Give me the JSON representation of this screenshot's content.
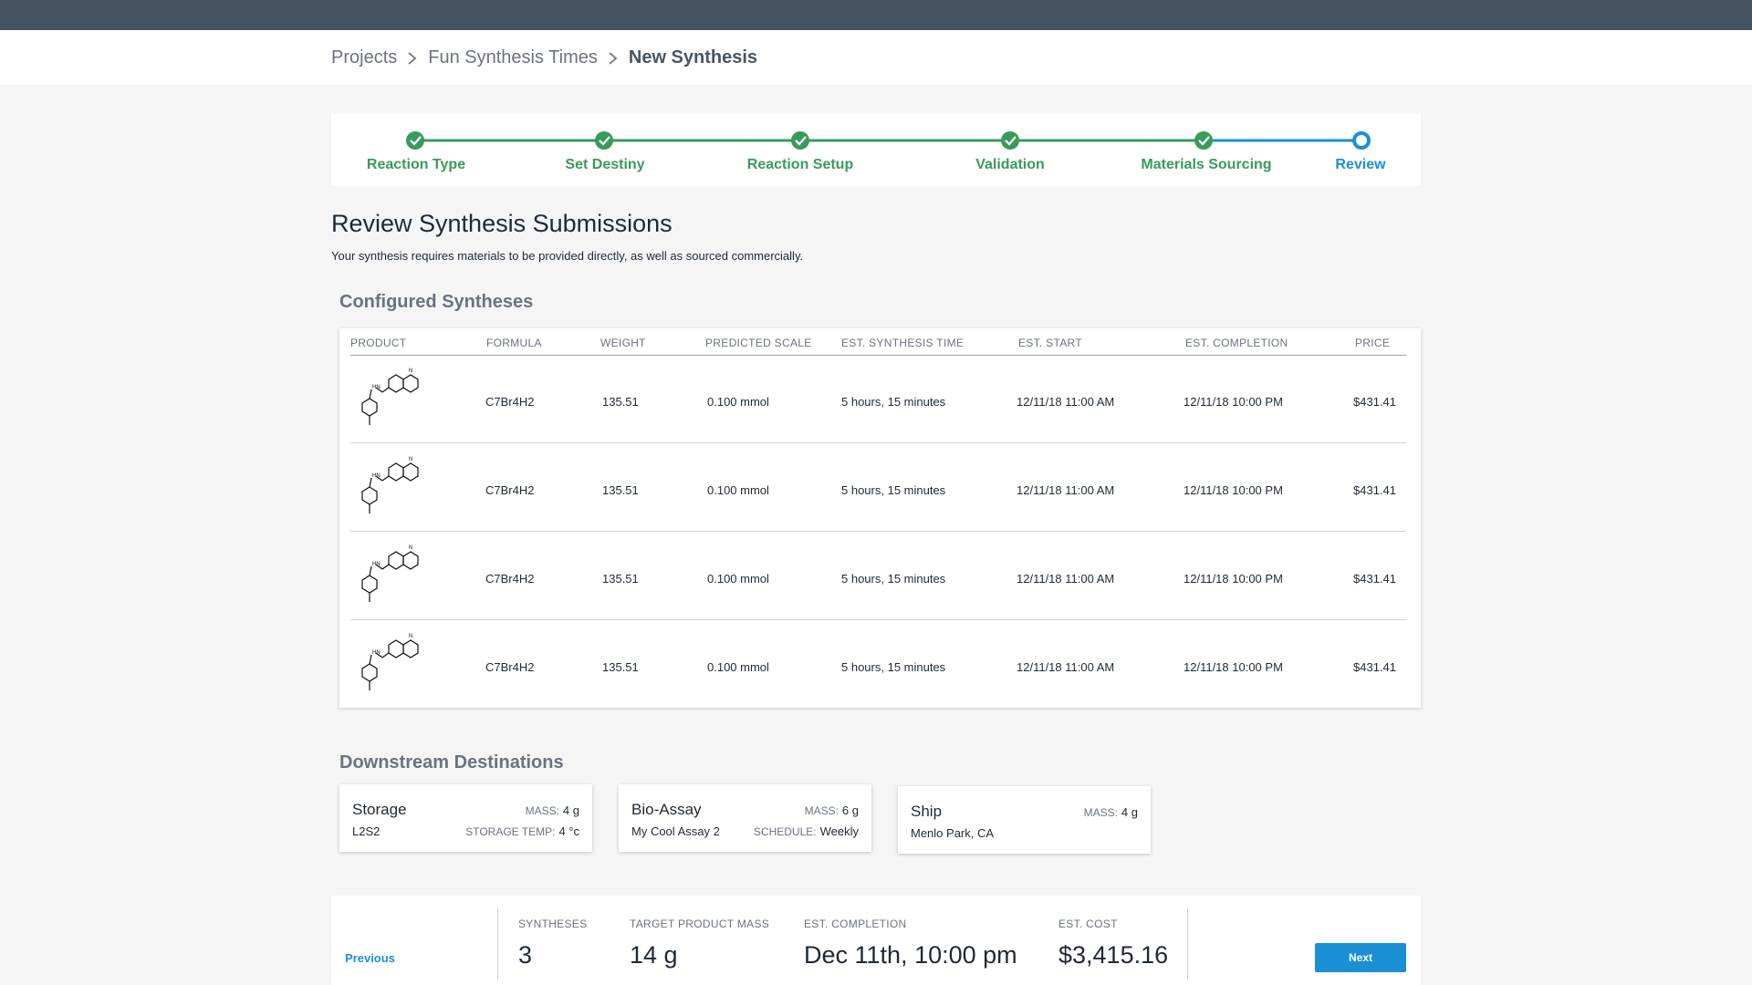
{
  "breadcrumb": {
    "items": [
      "Projects",
      "Fun Synthesis Times"
    ],
    "current": "New Synthesis"
  },
  "stepper": {
    "steps": [
      {
        "label": "Reaction Type",
        "status": "complete"
      },
      {
        "label": "Set Destiny",
        "status": "complete"
      },
      {
        "label": "Reaction Setup",
        "status": "complete"
      },
      {
        "label": "Validation",
        "status": "complete"
      },
      {
        "label": "Materials Sourcing",
        "status": "complete"
      },
      {
        "label": "Review",
        "status": "active"
      }
    ]
  },
  "page": {
    "title": "Review Synthesis Submissions",
    "subtitle": "Your synthesis requires materials to be provided directly, as well as sourced commercially."
  },
  "configured": {
    "title": "Configured Syntheses",
    "columns": [
      "PRODUCT",
      "FORMULA",
      "WEIGHT",
      "PREDICTED SCALE",
      "EST. SYNTHESIS TIME",
      "EST. START",
      "EST. COMPLETION",
      "PRICE"
    ],
    "rows": [
      {
        "formula": "C7Br4H2",
        "weight": "135.51",
        "scale": "0.100 mmol",
        "time": "5 hours, 15 minutes",
        "start": "12/11/18 11:00 AM",
        "completion": "12/11/18 10:00 PM",
        "price": "$431.41"
      },
      {
        "formula": "C7Br4H2",
        "weight": "135.51",
        "scale": "0.100 mmol",
        "time": "5 hours, 15 minutes",
        "start": "12/11/18 11:00 AM",
        "completion": "12/11/18 10:00 PM",
        "price": "$431.41"
      },
      {
        "formula": "C7Br4H2",
        "weight": "135.51",
        "scale": "0.100 mmol",
        "time": "5 hours, 15 minutes",
        "start": "12/11/18 11:00 AM",
        "completion": "12/11/18 10:00 PM",
        "price": "$431.41"
      },
      {
        "formula": "C7Br4H2",
        "weight": "135.51",
        "scale": "0.100 mmol",
        "time": "5 hours, 15 minutes",
        "start": "12/11/18 11:00 AM",
        "completion": "12/11/18 10:00 PM",
        "price": "$431.41"
      }
    ],
    "structure_labels": {
      "amine": "HN",
      "nitrogen": "N"
    }
  },
  "destinations": {
    "title": "Downstream Destinations",
    "cards": [
      {
        "name": "Storage",
        "sub": "L2S2",
        "k1": "MASS:",
        "v1": "4 g",
        "k2": "STORAGE TEMP:",
        "v2": "4 °c"
      },
      {
        "name": "Bio-Assay",
        "sub": "My Cool Assay 2",
        "k1": "MASS:",
        "v1": "6 g",
        "k2": "SCHEDULE:",
        "v2": "Weekly"
      },
      {
        "name": "Ship",
        "sub": "Menlo Park, CA",
        "k1": "MASS:",
        "v1": "4 g",
        "k2": "",
        "v2": ""
      }
    ]
  },
  "footer": {
    "previous": "Previous",
    "syntheses_label": "SYNTHESES",
    "syntheses_value": "3",
    "mass_label": "TARGET PRODUCT MASS",
    "mass_value": "14 g",
    "completion_label": "EST. COMPLETION",
    "completion_value": "Dec 11th, 10:00 pm",
    "cost_label": "EST. COST",
    "cost_value": "$3,415.16",
    "next": "Next"
  },
  "colors": {
    "topbar": "#465362",
    "complete": "#3a9a5b",
    "active": "#1b8fd6"
  }
}
